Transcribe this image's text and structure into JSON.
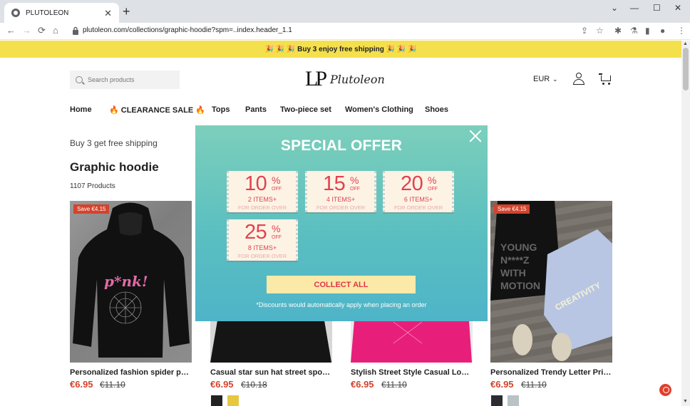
{
  "browser": {
    "tab_title": "PLUTOLEON",
    "tab_close": "✕",
    "new_tab": "+",
    "url": "plutoleon.com/collections/graphic-hoodie?spm=..index.header_1.1",
    "window_controls": [
      "⌄",
      "—",
      "☐",
      "✕"
    ]
  },
  "announcement": {
    "text": "🎉 🎉 🎉  Buy 3 enjoy free shipping 🎉 🎉 🎉"
  },
  "header": {
    "search_placeholder": "Search products",
    "logo_mark": "LP",
    "logo_text": "Plutoleon",
    "currency": "EUR",
    "currency_chevron": "⌄"
  },
  "nav": {
    "items": [
      "Home",
      "🔥 CLEARANCE SALE 🔥",
      "Tops",
      "Pants",
      "Two-piece set",
      "Women's Clothing",
      "Shoes"
    ]
  },
  "collection": {
    "promo": "Buy 3 get free shipping",
    "title": "Graphic hoodie",
    "count": "1107 Products"
  },
  "products": [
    {
      "badge": "Save €4.15",
      "title": "Personalized fashion spider pun...",
      "price": "€6.95",
      "old_price": "€11.10"
    },
    {
      "badge": "",
      "title": "Casual star sun hat street sports ...",
      "price": "€6.95",
      "old_price": "€10.18"
    },
    {
      "badge": "",
      "title": "Stylish Street Style Casual Loose...",
      "price": "€6.95",
      "old_price": "€11.10"
    },
    {
      "badge": "Save €4.15",
      "title": "Personalized Trendy Letter Print...",
      "price": "€6.95",
      "old_price": "€11.10"
    }
  ],
  "modal": {
    "title": "SPECIAL OFFER",
    "coupons": [
      {
        "percent": "10",
        "symbol": "%",
        "off": "OFF",
        "items": "2 ITEMS+",
        "condition": "FOR ORDER OVER"
      },
      {
        "percent": "15",
        "symbol": "%",
        "off": "OFF",
        "items": "4 ITEMS+",
        "condition": "FOR ORDER OVER"
      },
      {
        "percent": "20",
        "symbol": "%",
        "off": "OFF",
        "items": "6 ITEMS+",
        "condition": "FOR ORDER OVER"
      },
      {
        "percent": "25",
        "symbol": "%",
        "off": "OFF",
        "items": "8 ITEMS+",
        "condition": "FOR ORDER OVER"
      }
    ],
    "collect_label": "COLLECT ALL",
    "note": "*Discounts would automatically apply when placing an order"
  },
  "colors": {
    "accent_red": "#e04252",
    "announcement_bg": "#f4e04d",
    "modal_top": "#7ccfbb",
    "modal_bottom": "#4eb4c8"
  }
}
